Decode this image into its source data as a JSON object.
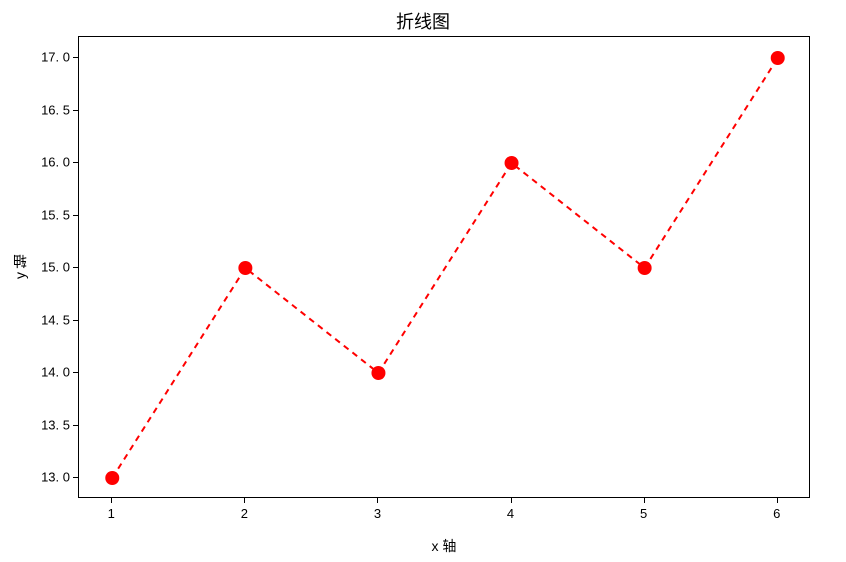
{
  "chart_data": {
    "type": "line",
    "x": [
      1,
      2,
      3,
      4,
      5,
      6
    ],
    "values": [
      13,
      15,
      14,
      16,
      15,
      17
    ],
    "title": "折线图",
    "xlabel": "x 轴",
    "ylabel": "y 轴",
    "xlim": [
      0.75,
      6.25
    ],
    "ylim": [
      12.8,
      17.2
    ],
    "xticks": [
      1,
      2,
      3,
      4,
      5,
      6
    ],
    "yticks": [
      13.0,
      13.5,
      14.0,
      14.5,
      15.0,
      15.5,
      16.0,
      16.5,
      17.0
    ],
    "xticklabels": [
      "1",
      "2",
      "3",
      "4",
      "5",
      "6"
    ],
    "yticklabels": [
      "13. 0",
      "13. 5",
      "14. 0",
      "14. 5",
      "15. 0",
      "15. 5",
      "16. 0",
      "16. 5",
      "17. 0"
    ],
    "line_color": "#ff0000",
    "line_style": "dashed",
    "marker": "circle",
    "marker_color": "#ff0000",
    "marker_size": 7
  }
}
